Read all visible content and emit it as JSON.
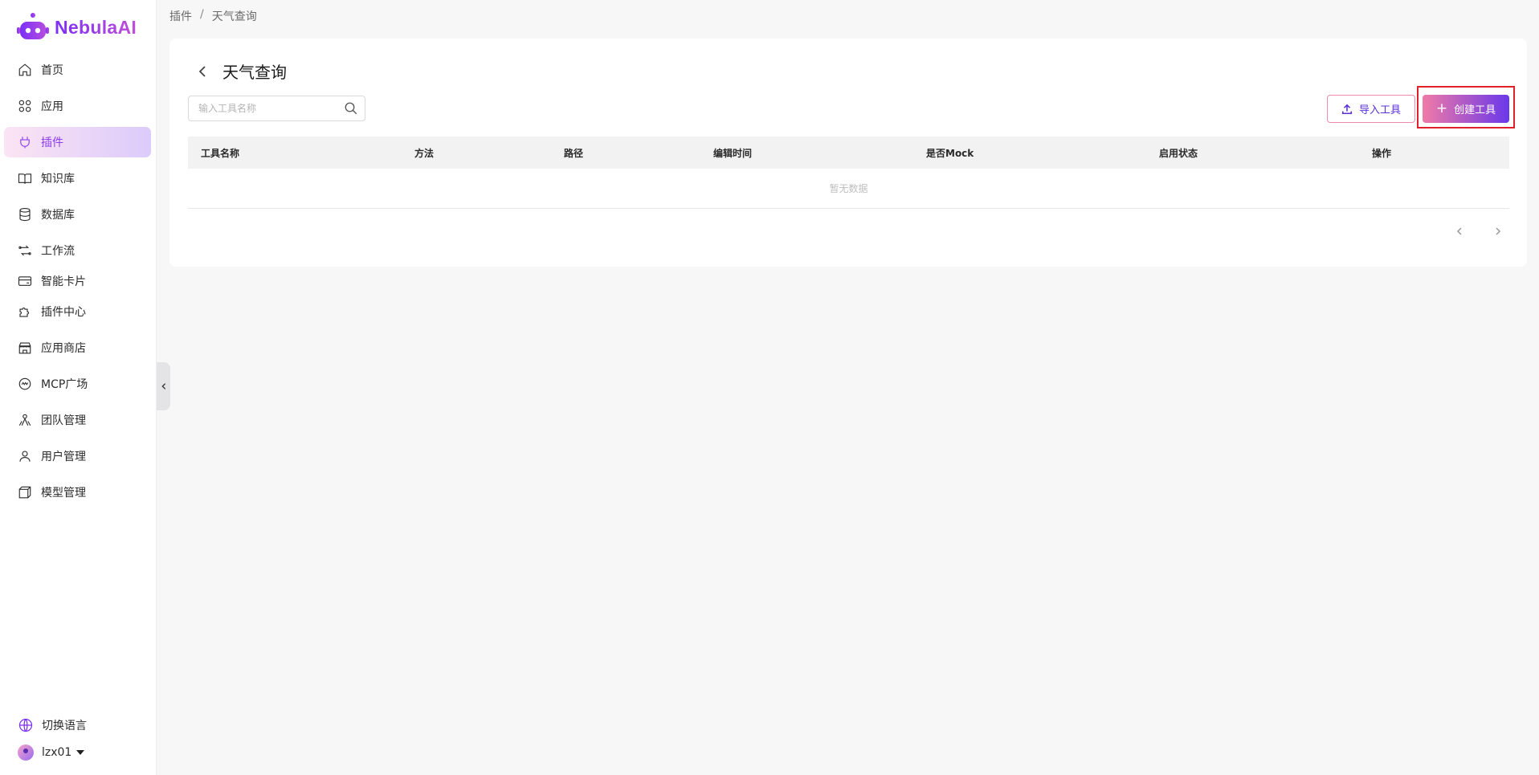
{
  "app": {
    "name": "NebulaAI",
    "accent": "#7b2ff7"
  },
  "sidebar": {
    "items": [
      {
        "label": "首页",
        "icon": "home-icon"
      },
      {
        "label": "应用",
        "icon": "apps-icon"
      },
      {
        "label": "插件",
        "icon": "plugin-icon",
        "active": true
      },
      {
        "label": "知识库",
        "icon": "book-icon"
      },
      {
        "label": "数据库",
        "icon": "database-icon"
      },
      {
        "label": "工作流",
        "icon": "workflow-icon"
      },
      {
        "label": "智能卡片",
        "icon": "card-icon"
      },
      {
        "label": "插件中心",
        "icon": "puzzle-icon"
      },
      {
        "label": "应用商店",
        "icon": "store-icon"
      },
      {
        "label": "MCP广场",
        "icon": "mcp-icon"
      },
      {
        "label": "团队管理",
        "icon": "team-icon"
      },
      {
        "label": "用户管理",
        "icon": "user-icon"
      },
      {
        "label": "模型管理",
        "icon": "model-icon"
      }
    ],
    "language": "切换语言",
    "username": "lzx01"
  },
  "breadcrumb": {
    "root": "插件",
    "sep": "/",
    "current": "天气查询"
  },
  "page": {
    "title": "天气查询",
    "search_placeholder": "输入工具名称",
    "import_label": "导入工具",
    "create_label": "创建工具"
  },
  "table": {
    "columns": [
      "工具名称",
      "方法",
      "路径",
      "编辑时间",
      "是否Mock",
      "启用状态",
      "操作"
    ],
    "empty_text": "暂无数据"
  }
}
